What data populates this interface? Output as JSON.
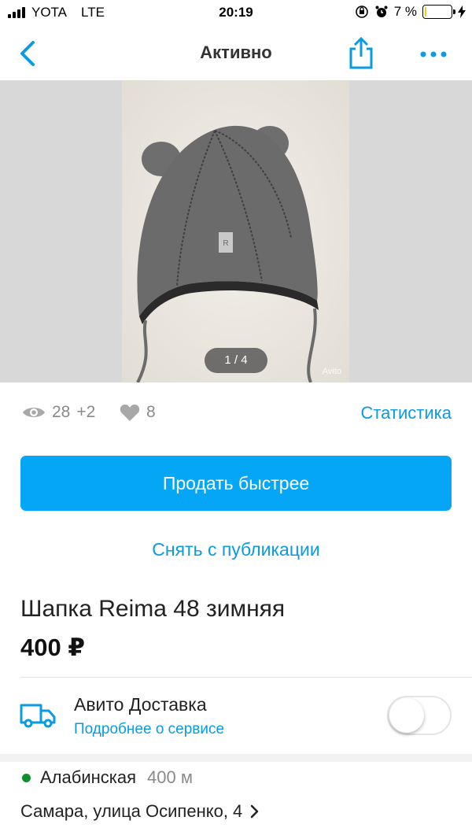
{
  "status_bar": {
    "carrier": "YOTA",
    "network": "LTE",
    "time": "20:19",
    "battery": "7 %",
    "battery_level": 0.07,
    "battery_color": "#f5c518"
  },
  "nav": {
    "title": "Активно",
    "back_icon": "chevron-left-icon",
    "share_icon": "share-icon",
    "more_icon": "more-icon"
  },
  "gallery": {
    "counter": "1 / 4",
    "watermark": "Avito"
  },
  "stats": {
    "views": "28",
    "views_new": "+2",
    "likes": "8",
    "stats_link": "Статистика"
  },
  "actions": {
    "promote_label": "Продать быстрее",
    "unpublish_label": "Снять с публикации"
  },
  "item": {
    "title": "Шапка Reima 48 зимняя",
    "price": "400 ₽"
  },
  "delivery": {
    "title": "Авито Доставка",
    "link": "Подробнее о сервисе",
    "enabled": false
  },
  "location": {
    "metro": "Алабинская",
    "metro_distance": "400 м",
    "metro_color": "#0f8f2f",
    "address": "Самара, улица Осипенко, 4"
  },
  "colors": {
    "accent": "#04a6f5",
    "link": "#0a9be0"
  }
}
